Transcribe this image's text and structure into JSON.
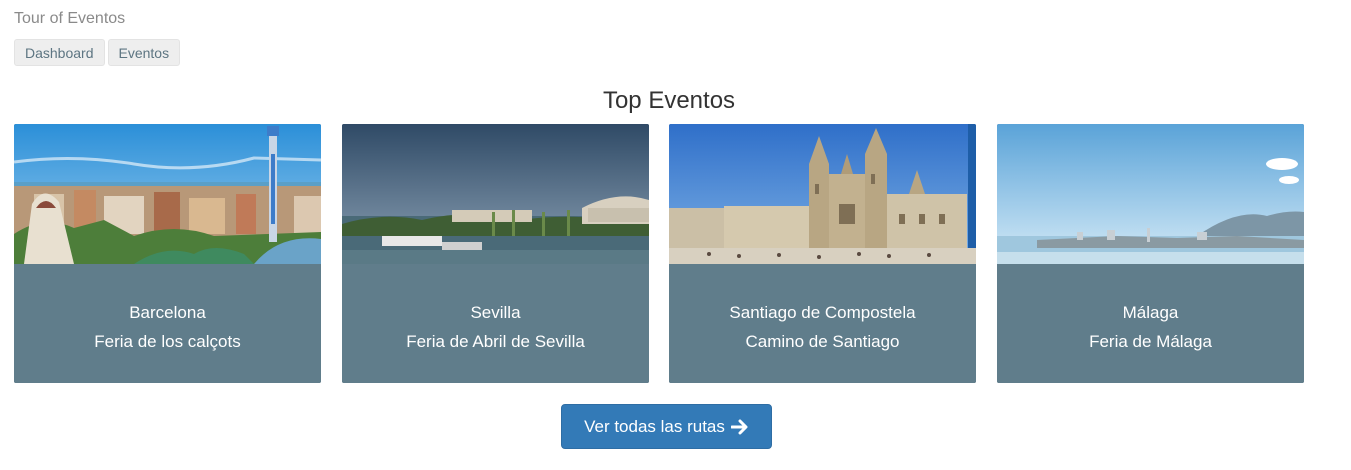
{
  "app": {
    "title": "Tour of Eventos"
  },
  "nav": {
    "items": [
      {
        "label": "Dashboard"
      },
      {
        "label": "Eventos"
      }
    ]
  },
  "main": {
    "heading": "Top Eventos",
    "cards": [
      {
        "city": "Barcelona",
        "event": "Feria de los calçots"
      },
      {
        "city": "Sevilla",
        "event": "Feria de Abril de Sevilla"
      },
      {
        "city": "Santiago de Compostela",
        "event": "Camino de Santiago"
      },
      {
        "city": "Málaga",
        "event": "Feria de Málaga"
      }
    ],
    "cta": {
      "label": "Ver todas las rutas",
      "icon": "arrow-right-icon"
    }
  },
  "colors": {
    "card_body": "#607d8b",
    "button_primary": "#337ab7",
    "nav_button_bg": "#eeeeee",
    "nav_button_text": "#5d7582"
  }
}
